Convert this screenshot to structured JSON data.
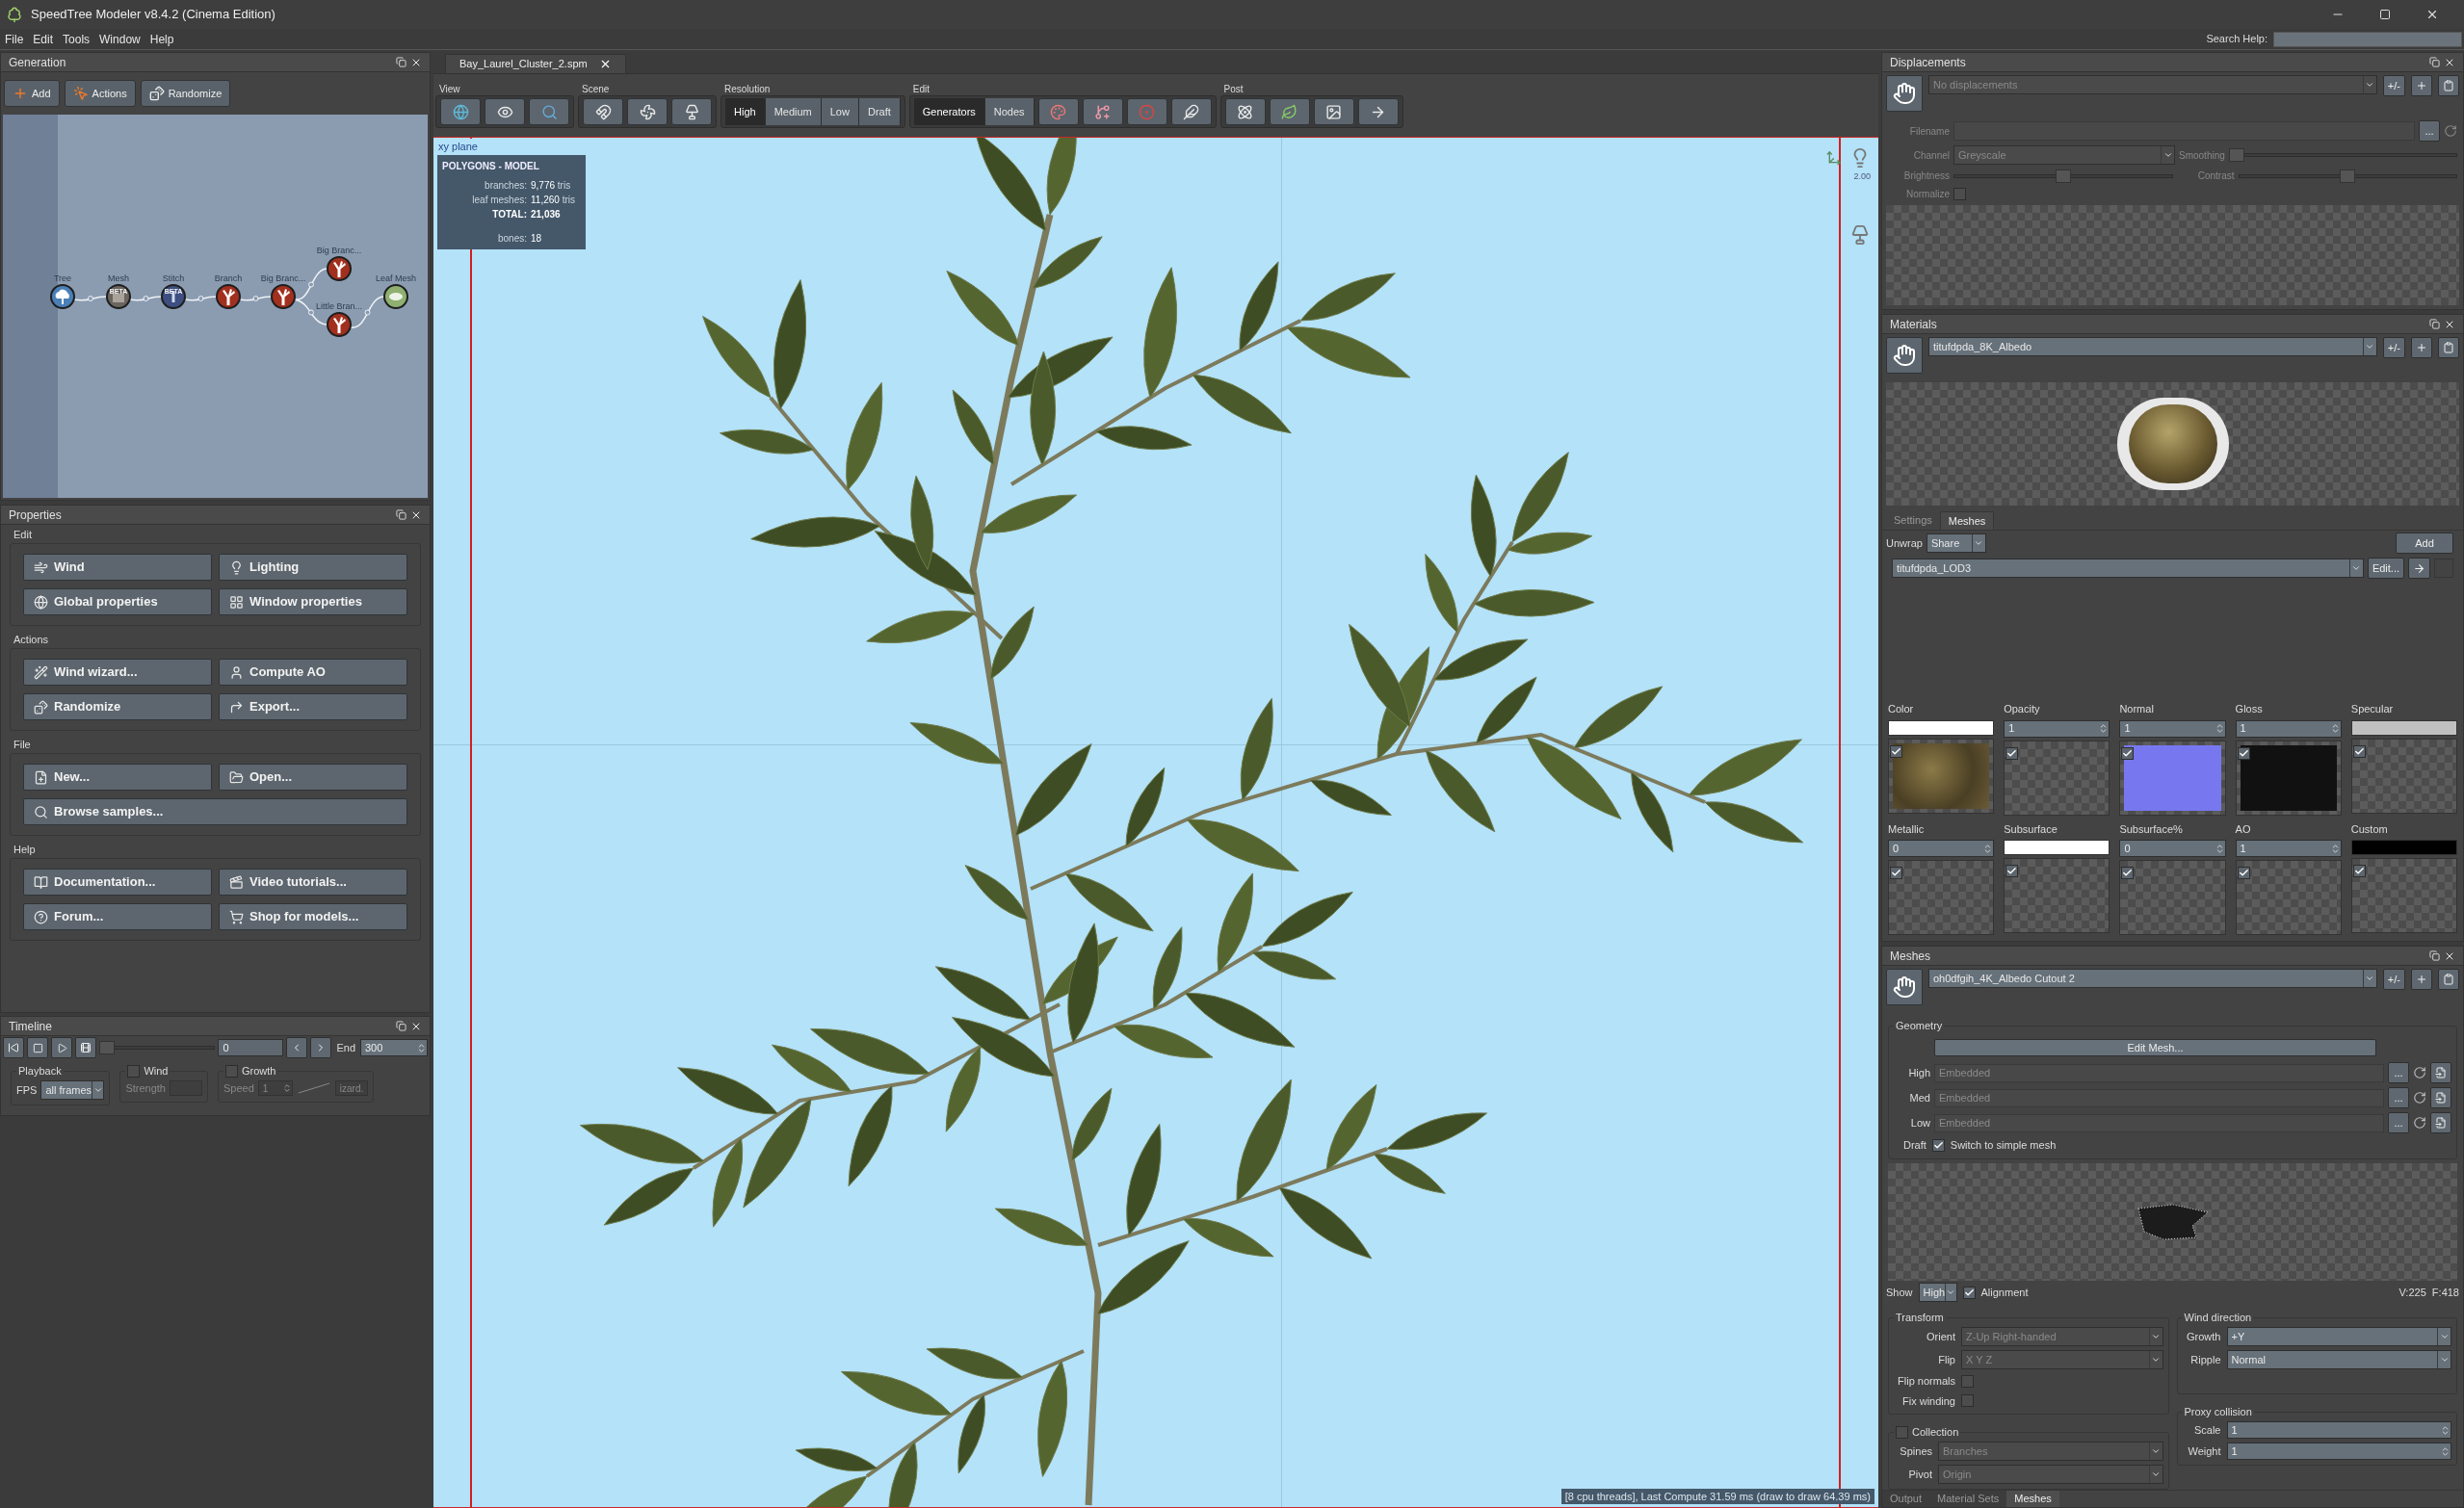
{
  "window": {
    "title": "SpeedTree Modeler v8.4.2 (Cinema Edition)"
  },
  "menu": [
    {
      "label": "File"
    },
    {
      "label": "Edit"
    },
    {
      "label": "Tools"
    },
    {
      "label": "Window"
    },
    {
      "label": "Help"
    }
  ],
  "search_help": {
    "label": "Search Help:"
  },
  "generation": {
    "title": "Generation",
    "toolbar": [
      {
        "label": "Add"
      },
      {
        "label": "Actions"
      },
      {
        "label": "Randomize"
      }
    ],
    "nodes": [
      {
        "label": "Tree",
        "kind": "tree"
      },
      {
        "label": "Mesh",
        "kind": "mesh",
        "badge": "BETA"
      },
      {
        "label": "Stitch",
        "kind": "stitch",
        "badge": "BETA"
      },
      {
        "label": "Branch",
        "kind": "branch"
      },
      {
        "label": "Big Branc...",
        "kind": "branch"
      },
      {
        "label": "Big Branc...",
        "kind": "branch"
      },
      {
        "label": "Little Bran...",
        "kind": "branch"
      },
      {
        "label": "Leaf Mesh",
        "kind": "leaf"
      }
    ]
  },
  "properties": {
    "title": "Properties",
    "groups": [
      {
        "title": "Edit",
        "buttons": [
          {
            "label": "Wind"
          },
          {
            "label": "Lighting"
          },
          {
            "label": "Global properties"
          },
          {
            "label": "Window properties"
          }
        ]
      },
      {
        "title": "Actions",
        "buttons": [
          {
            "label": "Wind wizard..."
          },
          {
            "label": "Compute AO"
          },
          {
            "label": "Randomize"
          },
          {
            "label": "Export..."
          }
        ]
      },
      {
        "title": "File",
        "buttons": [
          {
            "label": "New..."
          },
          {
            "label": "Open..."
          },
          {
            "label": "Browse samples..."
          }
        ]
      },
      {
        "title": "Help",
        "buttons": [
          {
            "label": "Documentation..."
          },
          {
            "label": "Video tutorials..."
          },
          {
            "label": "Forum..."
          },
          {
            "label": "Shop for models..."
          }
        ]
      }
    ]
  },
  "timeline": {
    "title": "Timeline",
    "scrub": {
      "level": 0
    },
    "frame": "0",
    "end_label": "End",
    "end": "300",
    "playback": {
      "title": "Playback",
      "fps_label": "FPS",
      "fps": "all frames"
    },
    "wind": {
      "label": "Wind",
      "checked": false,
      "strength_label": "Strength"
    },
    "growth": {
      "label": "Growth",
      "checked": false,
      "speed_label": "Speed",
      "speed": "1",
      "wizard_button": "izard."
    }
  },
  "document_tab": {
    "label": "Bay_Laurel_Cluster_2.spm"
  },
  "toolbar": {
    "view": {
      "title": "View"
    },
    "scene": {
      "title": "Scene"
    },
    "resolution": {
      "title": "Resolution",
      "options": [
        {
          "label": "High",
          "selected": true
        },
        {
          "label": "Medium",
          "selected": false
        },
        {
          "label": "Low",
          "selected": false
        },
        {
          "label": "Draft",
          "selected": false
        }
      ]
    },
    "edit": {
      "title": "Edit",
      "modes": [
        {
          "label": "Generators",
          "selected": true
        },
        {
          "label": "Nodes",
          "selected": false
        }
      ]
    },
    "post": {
      "title": "Post"
    }
  },
  "viewport": {
    "plane_label": "xy plane",
    "stats": {
      "title": "POLYGONS - MODEL",
      "rows": [
        {
          "kind": "tris",
          "label": "branches:",
          "value": "9,776",
          "unit": "tris"
        },
        {
          "kind": "tris",
          "label": "leaf meshes:",
          "value": "11,260",
          "unit": "tris"
        },
        {
          "kind": "total",
          "label": "TOTAL:",
          "value": "21,036"
        },
        {
          "kind": "spaced",
          "label": "bones:",
          "value": "18"
        }
      ]
    },
    "gizmo_value": "2.00",
    "status": "[8 cpu threads], Last Compute 31.59 ms (draw to draw 64.39 ms)"
  },
  "displacements": {
    "title": "Displacements",
    "selector": {
      "placeholder": "No displacements"
    },
    "plusminus": "+/-",
    "filename_label": "Filename",
    "browse": "...",
    "channel_label": "Channel",
    "channel": "Greyscale",
    "smoothing_label": "Smoothing",
    "smoothing": {
      "level": 0
    },
    "brightness_label": "Brightness",
    "brightness": {
      "level": 0.5
    },
    "contrast_label": "Contrast",
    "contrast": {
      "level": 0.5
    },
    "normalize_label": "Normalize",
    "normalize": {
      "checked": false
    }
  },
  "materials": {
    "title": "Materials",
    "selector": "titufdpda_8K_Albedo",
    "plusminus": "+/-",
    "tabs": [
      {
        "label": "Settings",
        "selected": false
      },
      {
        "label": "Meshes",
        "selected": true
      }
    ],
    "unwrap_label": "Unwrap",
    "unwrap": "Share",
    "add": "Add",
    "mesh": "titufdpda_LOD3",
    "edit": "Edit...",
    "maps": [
      {
        "label": "Color",
        "kind": "swatch",
        "color": "#ffffff",
        "checked": true
      },
      {
        "label": "Opacity",
        "kind": "number",
        "value": "1",
        "checked": true
      },
      {
        "label": "Normal",
        "kind": "number",
        "value": "1",
        "checked": true
      },
      {
        "label": "Gloss",
        "kind": "number",
        "value": "1",
        "checked": true
      },
      {
        "label": "Specular",
        "kind": "swatch",
        "color": "#c0c0c0",
        "checked": true
      },
      {
        "label": "Metallic",
        "kind": "number",
        "value": "0",
        "checked": true
      },
      {
        "label": "Subsurface",
        "kind": "swatch",
        "color": "#ffffff",
        "checked": true
      },
      {
        "label": "Subsurface%",
        "kind": "number",
        "value": "0",
        "checked": true
      },
      {
        "label": "AO",
        "kind": "number",
        "value": "1",
        "checked": true
      },
      {
        "label": "Custom",
        "kind": "swatch",
        "color": "#000000",
        "checked": true
      }
    ]
  },
  "meshes": {
    "title": "Meshes",
    "selector": "oh0dfgih_4K_Albedo Cutout 2",
    "plusminus": "+/-",
    "geometry": {
      "title": "Geometry",
      "edit_button": "Edit Mesh...",
      "lods": [
        {
          "label": "High",
          "value": "Embedded",
          "browse": "..."
        },
        {
          "label": "Med",
          "value": "Embedded",
          "browse": "..."
        },
        {
          "label": "Low",
          "value": "Embedded",
          "browse": "..."
        }
      ],
      "draft_label": "Draft",
      "draft": {
        "label": "Switch to simple mesh",
        "checked": true
      }
    },
    "show_label": "Show",
    "show": "High",
    "alignment": {
      "label": "Alignment",
      "checked": true
    },
    "counts": "V:225  F:418",
    "transform": {
      "title": "Transform",
      "orient_label": "Orient",
      "orient": "Z-Up Right-handed",
      "flip_label": "Flip",
      "flip": "X Y Z",
      "disabled": true,
      "flip_normals": {
        "label": "Flip normals",
        "checked": false
      },
      "fix_winding": {
        "label": "Fix winding",
        "checked": false
      }
    },
    "collection": {
      "label": "Collection",
      "checked": false,
      "spines_label": "Spines",
      "spines": "Branches",
      "pivot_label": "Pivot",
      "pivot": "Origin"
    },
    "wind_direction": {
      "title": "Wind direction",
      "growth_label": "Growth",
      "growth": "+Y",
      "ripple_label": "Ripple",
      "ripple": "Normal"
    },
    "proxy": {
      "title": "Proxy collision",
      "scale_label": "Scale",
      "scale": "1",
      "weight_label": "Weight",
      "weight": "1"
    },
    "bottom_tabs": [
      {
        "label": "Output",
        "selected": false
      },
      {
        "label": "Material Sets",
        "selected": false
      },
      {
        "label": "Meshes",
        "selected": true
      }
    ]
  }
}
